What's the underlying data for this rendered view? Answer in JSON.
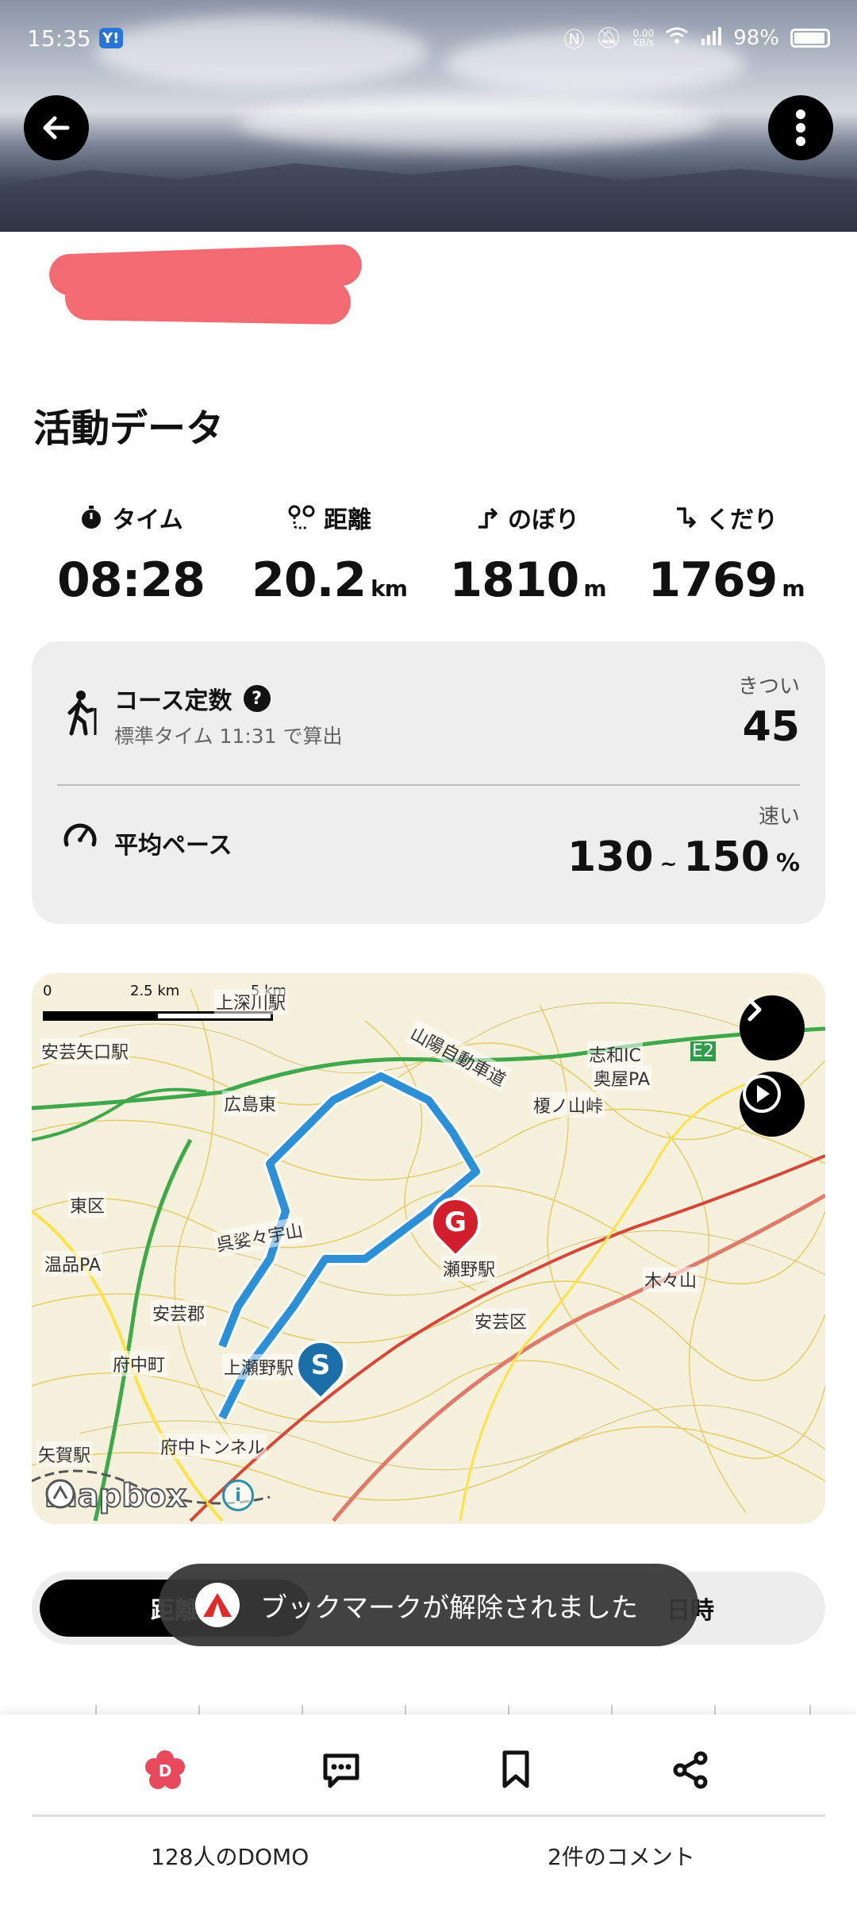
{
  "status": {
    "time": "15:35",
    "carrier_badge": "Y!",
    "net_speed_top": "0.00",
    "net_speed_unit": "KB/s",
    "battery": "98%"
  },
  "activity": {
    "title": "活動データ",
    "stats": [
      {
        "label": "タイム",
        "value": "08:28",
        "unit": "",
        "icon": "stopwatch-icon"
      },
      {
        "label": "距離",
        "value": "20.2",
        "unit": "km",
        "icon": "route-icon"
      },
      {
        "label": "のぼり",
        "value": "1810",
        "unit": "m",
        "icon": "ascent-icon"
      },
      {
        "label": "くだり",
        "value": "1769",
        "unit": "m",
        "icon": "descent-icon"
      }
    ]
  },
  "course": {
    "title": "コース定数",
    "help": "?",
    "subtitle": "標準タイム 11:31 で算出",
    "tag": "きつい",
    "value": "45"
  },
  "pace": {
    "title": "平均ペース",
    "tag": "速い",
    "value_min": "130",
    "separator": "~",
    "value_max": "150",
    "unit": "%"
  },
  "map": {
    "scale_labels": [
      "0",
      "2.5 km",
      "5 km"
    ],
    "start_marker": "S",
    "goal_marker": "G",
    "attribution": "mapbox",
    "info": "i",
    "places": [
      "安芸矢口駅",
      "広島東",
      "山陽自動車道",
      "志和IC",
      "奥屋PA",
      "榎ノ山峠",
      "東区",
      "温品PA",
      "呉娑々宇山",
      "安芸郡",
      "府中町",
      "安芸区",
      "瀬野駅",
      "木々山",
      "上深川駅",
      "府中トンネル",
      "上瀬野駅",
      "矢賀駅",
      "E2"
    ]
  },
  "tabs": {
    "active": "距離",
    "right": "日時"
  },
  "toast": {
    "message": "ブックマークが解除されました"
  },
  "footer": {
    "domo_count": "128人のDOMO",
    "comment_count": "2件のコメント",
    "domo_icon_letter": "D"
  },
  "colors": {
    "route": "#2d8fd6",
    "goal": "#d11f2e",
    "start": "#1b6fa8",
    "redaction": "#f26b72",
    "domo": "#e8495c"
  }
}
